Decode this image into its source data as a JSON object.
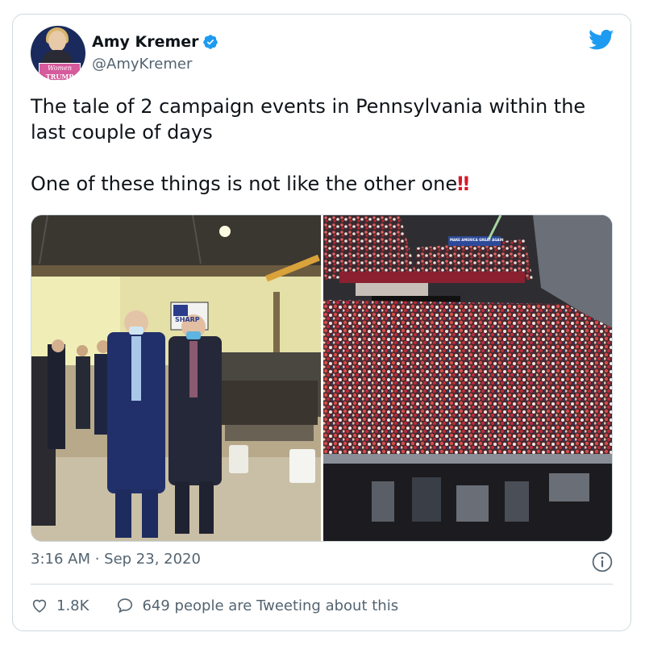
{
  "author": {
    "name": "Amy Kremer",
    "handle": "@AmyKremer",
    "avatar_sign_line1": "Women",
    "avatar_sign_line2": "TRUMP"
  },
  "tweet": {
    "line1": "The tale of 2 campaign events in Pennsylvania within the last couple of days",
    "line2": "One of these things is not like the other one",
    "emphasis": "‼"
  },
  "media": {
    "left_sign_text": "SHARP",
    "right_banner_text": "MAKE AMERICA GREAT AGAIN"
  },
  "meta": {
    "timestamp": "3:16 AM · Sep 23, 2020"
  },
  "engagement": {
    "likes": "1.8K",
    "tweeting": "649 people are Tweeting about this"
  },
  "colors": {
    "brand_blue": "#1d9bf0",
    "text_secondary": "#536471",
    "emphasis_red": "#d8182a"
  },
  "icons": [
    "verified-badge-icon",
    "twitter-bird-icon",
    "info-icon",
    "heart-icon",
    "speech-bubble-icon"
  ]
}
